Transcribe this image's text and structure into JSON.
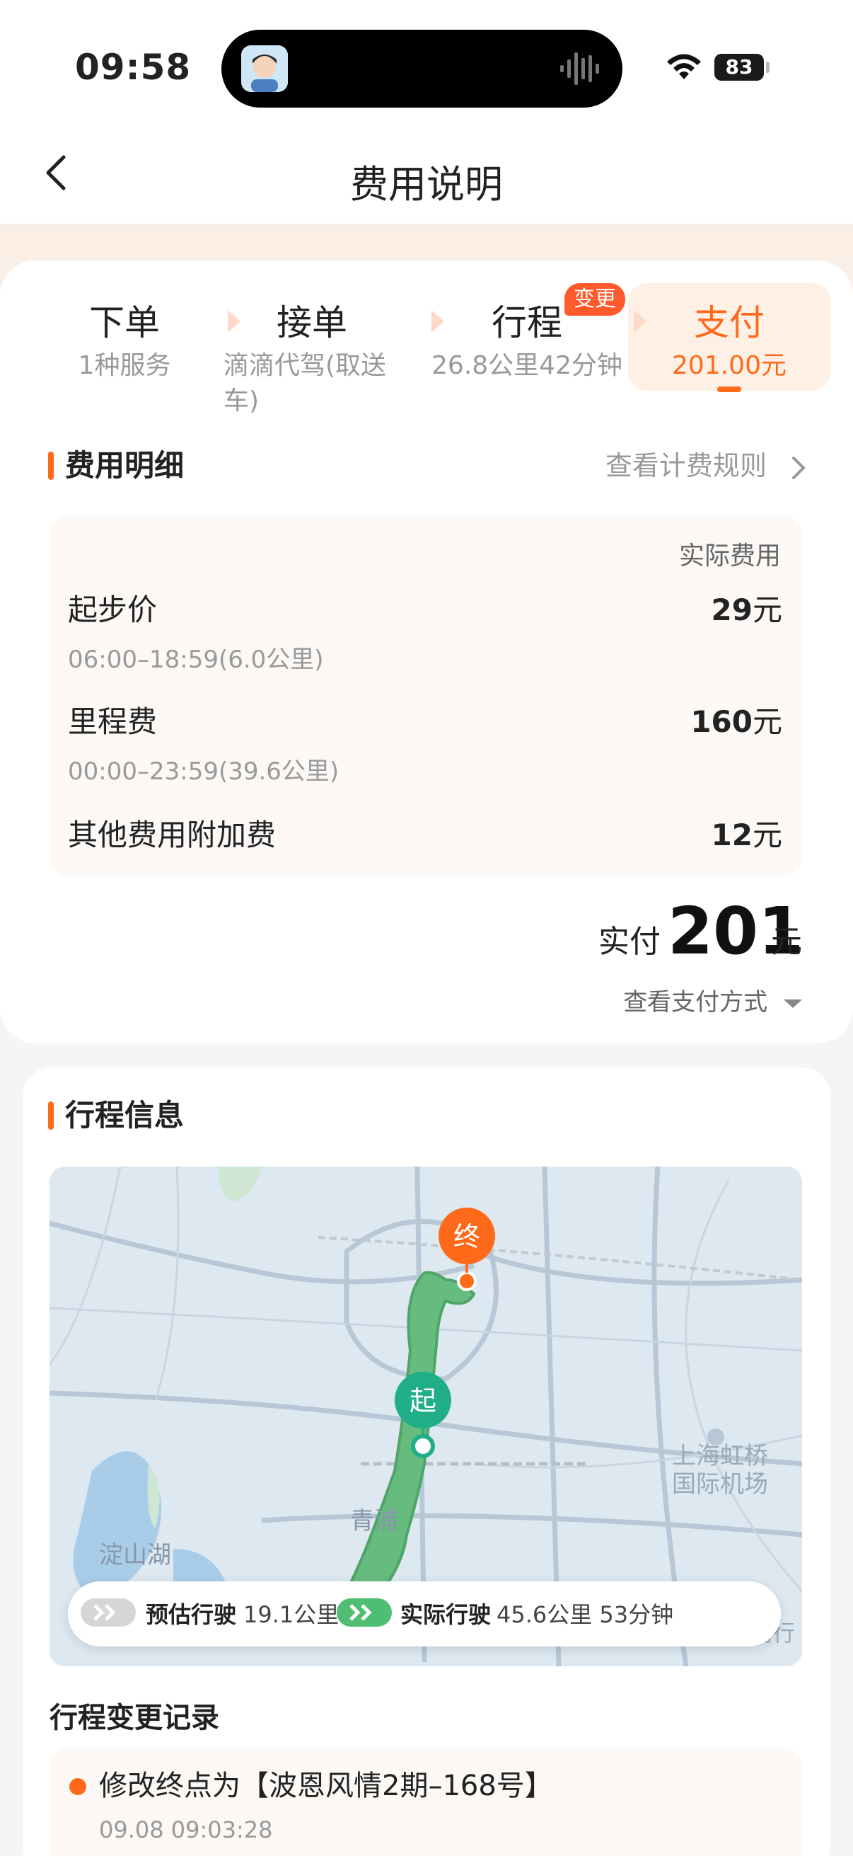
{
  "status": {
    "time": "09:58",
    "battery": "83"
  },
  "nav": {
    "title": "费用说明"
  },
  "steps": [
    {
      "title": "下单",
      "sub": "1种服务"
    },
    {
      "title": "接单",
      "sub": "滴滴代驾(取送车)"
    },
    {
      "title": "行程",
      "sub": "26.8公里42分钟",
      "badge": "变更"
    },
    {
      "title": "支付",
      "sub": "201.00元"
    }
  ],
  "fee": {
    "section_title": "费用明细",
    "rule_link": "查看计费规则",
    "header": "实际费用",
    "items": [
      {
        "name": "起步价",
        "sub": "06:00–18:59(6.0公里)",
        "amount": "29",
        "unit": "元"
      },
      {
        "name": "里程费",
        "sub": "00:00–23:59(39.6公里)",
        "amount": "160",
        "unit": "元"
      },
      {
        "name": "其他费用附加费",
        "sub": "",
        "amount": "12",
        "unit": "元"
      }
    ],
    "paid_label": "实付",
    "paid_amount": "201",
    "paid_unit": "元",
    "pay_method": "查看支付方式"
  },
  "trip": {
    "section_title": "行程信息",
    "map_labels": {
      "end": "终",
      "start": "起",
      "airport_line1": "上海虹桥",
      "airport_line2": "国际机场",
      "lake": "淀山湖",
      "town": "青浦",
      "edge": "闵行"
    },
    "legend": {
      "estimated_label": "预估行驶",
      "estimated_value": "19.1公里",
      "actual_label": "实际行驶",
      "actual_value": "45.6公里 53分钟"
    },
    "change_title": "行程变更记录",
    "changes": [
      {
        "text": "修改终点为【波恩风情2期–168号】",
        "time": "09.08 09:03:28"
      }
    ]
  },
  "colors": {
    "accent": "#ff6a1a",
    "route_green": "#5db878",
    "start_teal": "#1fae87"
  }
}
